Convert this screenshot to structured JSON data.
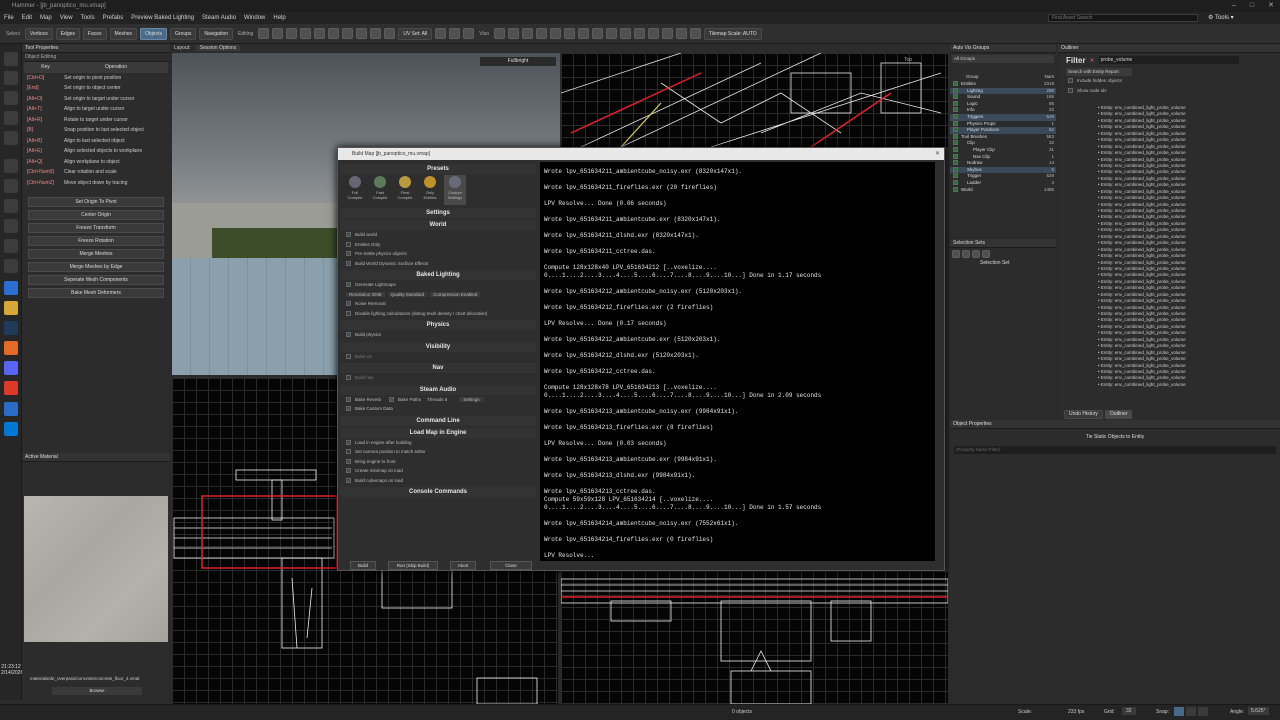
{
  "window": {
    "title": "Hammer - [jb_panoptico_mu.vmap]"
  },
  "menu": [
    "File",
    "Edit",
    "Map",
    "View",
    "Tools",
    "Prefabs",
    "Preview Baked Lighting",
    "Steam Audio",
    "Window",
    "Help"
  ],
  "search": {
    "placeholder": "Find Asset Search"
  },
  "tools_menu": "Tools",
  "toolbar": {
    "select_label": "Select",
    "modes": [
      "Vertices",
      "Edges",
      "Faces",
      "Meshes",
      "Objects",
      "Groups",
      "Navigation"
    ],
    "editing_label": "Editing",
    "uvset_label": "UV Set: All",
    "vison_label": "Viso",
    "tilemap_label": "Tilemap Scale: AUTO"
  },
  "layout_bar": {
    "layout": "Layout:",
    "session_options": "Session Options"
  },
  "tool_properties": {
    "title": "Tool Properties",
    "subtitle": "Object Editing",
    "headers": {
      "key": "Key",
      "operation": "Operation"
    },
    "rows": [
      {
        "key": "[Ctrl+D]",
        "op": "Set origin to pivot position"
      },
      {
        "key": "[End]",
        "op": "Set origin to object center"
      },
      {
        "key": "[Alt+O]",
        "op": "Set origin to target under cursor"
      },
      {
        "key": "[Alt+T]",
        "op": "Align to target under cursor"
      },
      {
        "key": "[Alt+R]",
        "op": "Rotate to target under cursor"
      },
      {
        "key": "[B]",
        "op": "Snap position to last selected object"
      },
      {
        "key": "[Alt+B]",
        "op": "Align to last selected object"
      },
      {
        "key": "[Alt+E]",
        "op": "Align selected objects to workplane"
      },
      {
        "key": "[Alt+Q]",
        "op": "Align workplane to object"
      },
      {
        "key": "[Ctrl+Num0]",
        "op": "Clear rotation and scale"
      },
      {
        "key": "[Ctrl+NumZ]",
        "op": "Move object down by tracing"
      }
    ],
    "buttons": [
      "Set Origin To Pivot",
      "Center Origin",
      "Freeze Transform",
      "Freeze Rotation",
      "Merge Meshes",
      "Merge Meshes by Edge",
      "Seperate Mesh Components",
      "Bake Mesh Deformers"
    ]
  },
  "active_material": {
    "title": "Active Material",
    "path": "materials/de_overpass/concrete/concrete_floor_4.vmat",
    "browse": "Browse"
  },
  "clock": {
    "time": "21:23:12",
    "date": "2/14/2026"
  },
  "viewport": {
    "render_mode": "Fullbright",
    "top_label": "Top"
  },
  "build": {
    "title": "Build Map [jb_panoptico_mu.vmap]",
    "presets_title": "Presets",
    "presets": [
      "Full Compile",
      "Fast Compile",
      "Final Compile",
      "Only Entities",
      "Custom Settings"
    ],
    "settings_title": "Settings",
    "world_title": "World",
    "world": [
      {
        "label": "Build world",
        "on": true
      },
      {
        "label": "Entities Only",
        "on": false
      },
      {
        "label": "Pre-Settle physics objects",
        "on": true
      },
      {
        "label": "Build World Dynamic Surface Effects",
        "on": true
      }
    ],
    "baked_title": "Baked Lighting",
    "generate_lightmaps": "Generate Lightmaps",
    "resolution": "Resolution 2048",
    "quality": "Quality Standard",
    "compression": "Compression Enabled",
    "noise_removal": "Noise Removal",
    "disable_lighting": "Disable lighting calculations (debug texel density / chart allocation)",
    "physics_title": "Physics",
    "build_physics": "Build physics",
    "visibility_title": "Visibility",
    "build_vis": "Build vis",
    "nav_title": "Nav",
    "build_nav": "Build nav",
    "steam_audio_title": "Steam Audio",
    "bake_reverb": "Bake Reverb",
    "bake_paths": "Bake Paths",
    "threads": "Threads 8",
    "audio_settings": "Settings",
    "bake_custom": "Bake Custom Data",
    "cmdline_title": "Command Line",
    "load_title": "Load Map in Engine",
    "load": [
      {
        "label": "Load in engine after building",
        "on": true
      },
      {
        "label": "Set camera position to match editor",
        "on": false
      },
      {
        "label": "Bring engine to front",
        "on": true
      },
      {
        "label": "Create minimap on load",
        "on": true
      },
      {
        "label": "Build cubemaps on load",
        "on": true
      }
    ],
    "console_cmds_title": "Console Commands",
    "buttons": [
      "Build",
      "Run (Skip Build)",
      "Abort",
      "Close"
    ],
    "console": [
      "Wrote lpv_651634211_ambientcube_noisy.exr (8320x147x1).",
      "",
      "Wrote lpv_651634211_fireflies.exr (20 fireflies)",
      "",
      "LPV Resolve... Done (0.06 seconds)",
      "",
      "Wrote lpv_651634211_ambientcube.exr (8320x147x1).",
      "",
      "Wrote lpv_651634211_dlshd.exr (8320x147x1).",
      "",
      "Wrote lpv_651634211_cctree.das.",
      "",
      "Compute 128x128x40 LPV_651634212 [..voxelize....",
      "0....1....2....3....4....5....6....7....8....9....10...] Done in 1.17 seconds",
      "",
      "Wrote lpv_651634212_ambientcube_noisy.exr (5120x203x1).",
      "",
      "Wrote lpv_651634212_fireflies.exr (2 fireflies)",
      "",
      "LPV Resolve... Done (0.17 seconds)",
      "",
      "Wrote lpv_651634212_ambientcube.exr (5120x203x1).",
      "",
      "Wrote lpv_651634212_dlshd.exr (5120x203x1).",
      "",
      "Wrote lpv_651634212_cctree.das.",
      "",
      "Compute 128x128x78 LPV_651634213 [..voxelize....",
      "0....1....2....3....4....5....6....7....8....9....10...] Done in 2.09 seconds",
      "",
      "Wrote lpv_651634213_ambientcube_noisy.exr (9984x91x1).",
      "",
      "Wrote lpv_651634213_fireflies.exr (8 fireflies)",
      "",
      "LPV Resolve... Done (0.03 seconds)",
      "",
      "Wrote lpv_651634213_ambientcube.exr (9984x91x1).",
      "",
      "Wrote lpv_651634213_dlshd.exr (9984x91x1).",
      "",
      "Wrote lpv_651634213_cctree.das.",
      "Compute 59x59x128 LPV_651634214 [..voxelize....",
      "0....1....2....3....4....5....6....7....8....9....10...] Done in 1.57 seconds",
      "",
      "Wrote lpv_651634214_ambientcube_noisy.exr (7552x61x1).",
      "",
      "Wrote lpv_651634214_fireflies.exr (0 fireflies)",
      "",
      "LPV Resolve..."
    ]
  },
  "autovis": {
    "title": "Auto Vis Groups",
    "filter": "All Groups",
    "header_group": "Group",
    "header_num": "Num",
    "rows": [
      {
        "name": "Entities",
        "num": "2319",
        "indent": 0
      },
      {
        "name": "Lighting",
        "num": "298",
        "indent": 1
      },
      {
        "name": "Sound",
        "num": "186",
        "indent": 1
      },
      {
        "name": "Logic",
        "num": "95",
        "indent": 1
      },
      {
        "name": "Info",
        "num": "32",
        "indent": 1
      },
      {
        "name": "Triggers",
        "num": "529",
        "indent": 1
      },
      {
        "name": "Physics Props",
        "num": "1",
        "indent": 1
      },
      {
        "name": "Player Positions",
        "num": "82",
        "indent": 1
      },
      {
        "name": "Tool Brushes",
        "num": "583",
        "indent": 0
      },
      {
        "name": "Clip",
        "num": "32",
        "indent": 1
      },
      {
        "name": "Player Clip",
        "num": "31",
        "indent": 2
      },
      {
        "name": "Nav Clip",
        "num": "1",
        "indent": 2
      },
      {
        "name": "Nodraw",
        "num": "14",
        "indent": 1
      },
      {
        "name": "Skybox",
        "num": "5",
        "indent": 1
      },
      {
        "name": "Trigger",
        "num": "529",
        "indent": 1
      },
      {
        "name": "Ladder",
        "num": "4",
        "indent": 1
      },
      {
        "name": "World",
        "num": "1495",
        "indent": 0
      }
    ]
  },
  "selection_sets": {
    "title": "Selection Sets",
    "header": "Selection Set"
  },
  "outliner": {
    "title": "Outliner",
    "filter_label": "Filter",
    "filter_value": "probe_volume",
    "search_report": "Search with Entity Report",
    "include_hidden": "Include hidden objects",
    "show_node_ids": "Show node ids",
    "entity_label": "Entity: env_combined_light_probe_volume",
    "entity_count": 44,
    "tabs": [
      "Undo History",
      "Outliner"
    ]
  },
  "object_properties": {
    "title": "Object Properties",
    "tie_button": "Tie Static Objects to Entity",
    "filter_placeholder": "(Property Name Filter)"
  },
  "status": {
    "objects": "0 objects",
    "scale": "Scale:",
    "fps": "233 fps",
    "grid_label": "Grid:",
    "grid_value": "32",
    "snap_label": "Snap:",
    "angle_label": "Angle:",
    "angle_value": "5.625°"
  },
  "colors": {
    "accent": "#4a6a8a",
    "wire_red": "#e0202a",
    "console_bg": "#000000"
  }
}
